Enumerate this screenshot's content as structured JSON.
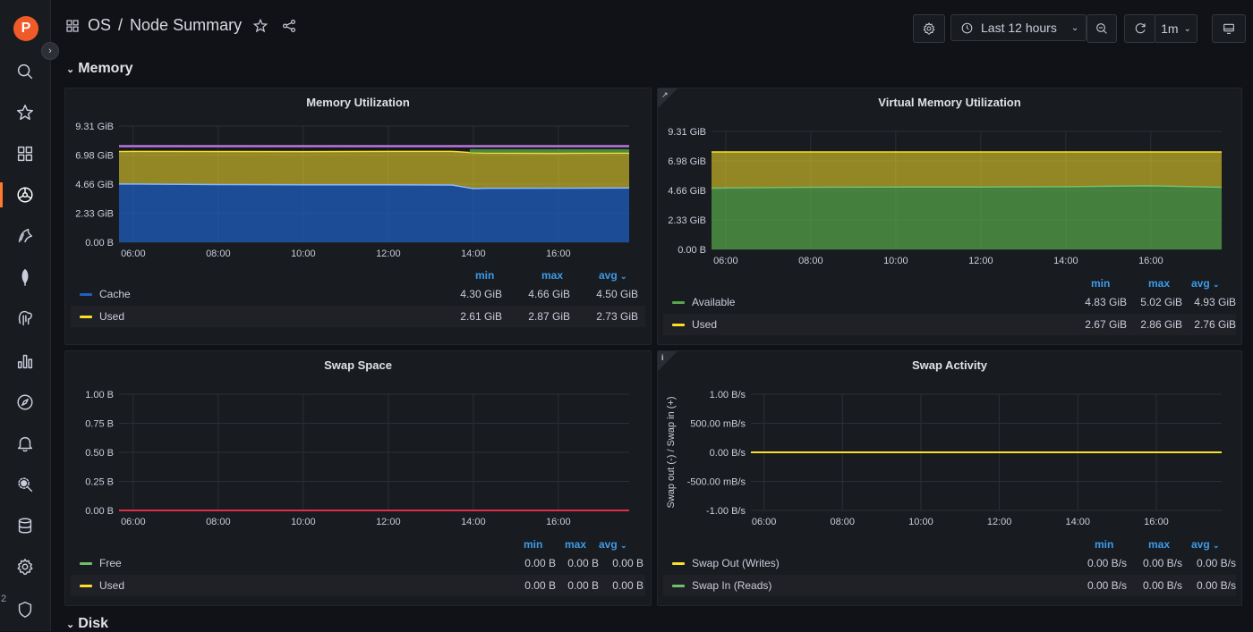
{
  "breadcrumb": {
    "folder": "OS",
    "separator": "/",
    "dashboard": "Node Summary"
  },
  "toolbar": {
    "time_range": "Last 12 hours",
    "refresh_interval": "1m"
  },
  "rows": {
    "memory": "Memory",
    "disk": "Disk"
  },
  "stray_text": "2",
  "legend_headers": {
    "min": "min",
    "max": "max",
    "avg": "avg"
  },
  "colors": {
    "cache": "#1f60c4",
    "used": "#fade2a",
    "free": "#73bf69",
    "available": "#56a64b",
    "purple": "#b877d9",
    "red": "#e02f44"
  },
  "panels": {
    "mem_util": {
      "title": "Memory Utilization",
      "y_ticks": [
        "9.31 GiB",
        "6.98 GiB",
        "4.66 GiB",
        "2.33 GiB",
        "0.00 B"
      ],
      "x_ticks": [
        "06:00",
        "08:00",
        "10:00",
        "12:00",
        "14:00",
        "16:00"
      ],
      "series": [
        {
          "name": "Cache",
          "min": "4.30 GiB",
          "max": "4.66 GiB",
          "avg": "4.50 GiB"
        },
        {
          "name": "Used",
          "min": "2.61 GiB",
          "max": "2.87 GiB",
          "avg": "2.73 GiB"
        }
      ]
    },
    "vmem_util": {
      "title": "Virtual Memory Utilization",
      "y_ticks": [
        "9.31 GiB",
        "6.98 GiB",
        "4.66 GiB",
        "2.33 GiB",
        "0.00 B"
      ],
      "x_ticks": [
        "06:00",
        "08:00",
        "10:00",
        "12:00",
        "14:00",
        "16:00"
      ],
      "series": [
        {
          "name": "Available",
          "min": "4.83 GiB",
          "max": "5.02 GiB",
          "avg": "4.93 GiB"
        },
        {
          "name": "Used",
          "min": "2.67 GiB",
          "max": "2.86 GiB",
          "avg": "2.76 GiB"
        }
      ]
    },
    "swap_space": {
      "title": "Swap Space",
      "y_ticks": [
        "1.00 B",
        "0.75 B",
        "0.50 B",
        "0.25 B",
        "0.00 B"
      ],
      "x_ticks": [
        "06:00",
        "08:00",
        "10:00",
        "12:00",
        "14:00",
        "16:00"
      ],
      "series": [
        {
          "name": "Free",
          "min": "0.00 B",
          "max": "0.00 B",
          "avg": "0.00 B"
        },
        {
          "name": "Used",
          "min": "0.00 B",
          "max": "0.00 B",
          "avg": "0.00 B"
        }
      ]
    },
    "swap_activity": {
      "title": "Swap Activity",
      "y_axis_label": "Swap out (-) / Swap in (+)",
      "y_ticks": [
        "1.00 B/s",
        "500.00 mB/s",
        "0.00 B/s",
        "-500.00 mB/s",
        "-1.00 B/s"
      ],
      "x_ticks": [
        "06:00",
        "08:00",
        "10:00",
        "12:00",
        "14:00",
        "16:00"
      ],
      "series": [
        {
          "name": "Swap Out (Writes)",
          "min": "0.00 B/s",
          "max": "0.00 B/s",
          "avg": "0.00 B/s"
        },
        {
          "name": "Swap In (Reads)",
          "min": "0.00 B/s",
          "max": "0.00 B/s",
          "avg": "0.00 B/s"
        }
      ]
    }
  },
  "chart_data": [
    {
      "type": "area",
      "title": "Memory Utilization",
      "x": [
        "05:40",
        "06:00",
        "08:00",
        "10:00",
        "12:00",
        "13:30",
        "14:00",
        "14:15",
        "16:00",
        "17:40"
      ],
      "series": [
        {
          "name": "Cache",
          "values": [
            4.66,
            4.66,
            4.62,
            4.6,
            4.6,
            4.58,
            4.3,
            4.32,
            4.33,
            4.35
          ]
        },
        {
          "name": "Used",
          "values": [
            2.61,
            2.62,
            2.65,
            2.66,
            2.68,
            2.7,
            2.87,
            2.82,
            2.8,
            2.79
          ]
        }
      ],
      "ylim": [
        0,
        9.31
      ],
      "y_unit": "GiB",
      "grid": true,
      "legend": "bottom"
    },
    {
      "type": "area",
      "title": "Virtual Memory Utilization",
      "x": [
        "05:40",
        "06:00",
        "08:00",
        "10:00",
        "12:00",
        "14:00",
        "16:00",
        "17:40"
      ],
      "series": [
        {
          "name": "Available",
          "values": [
            4.83,
            4.85,
            4.9,
            4.92,
            4.92,
            4.95,
            5.02,
            4.9
          ]
        },
        {
          "name": "Used",
          "values": [
            2.86,
            2.84,
            2.79,
            2.77,
            2.77,
            2.74,
            2.67,
            2.79
          ]
        }
      ],
      "ylim": [
        0,
        9.31
      ],
      "y_unit": "GiB",
      "grid": true,
      "legend": "bottom"
    },
    {
      "type": "line",
      "title": "Swap Space",
      "x": [
        "05:40",
        "17:40"
      ],
      "series": [
        {
          "name": "Free",
          "values": [
            0,
            0
          ]
        },
        {
          "name": "Used",
          "values": [
            0,
            0
          ]
        }
      ],
      "ylim": [
        0,
        1
      ],
      "y_unit": "B",
      "grid": true,
      "legend": "bottom"
    },
    {
      "type": "line",
      "title": "Swap Activity",
      "x": [
        "05:40",
        "17:40"
      ],
      "series": [
        {
          "name": "Swap Out (Writes)",
          "values": [
            0,
            0
          ]
        },
        {
          "name": "Swap In (Reads)",
          "values": [
            0,
            0
          ]
        }
      ],
      "ylim": [
        -1,
        1
      ],
      "y_unit": "B/s",
      "ylabel": "Swap out (-) / Swap in (+)",
      "grid": true,
      "legend": "bottom"
    }
  ]
}
